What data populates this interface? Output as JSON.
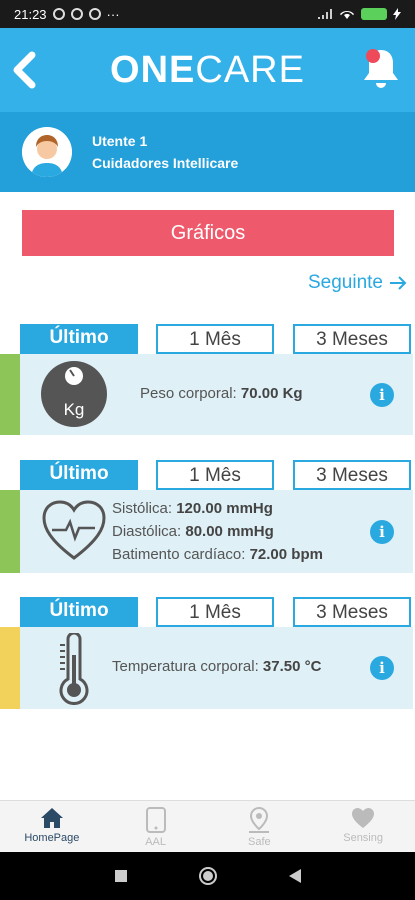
{
  "status_bar": {
    "time": "21:23",
    "dots": "···"
  },
  "header": {
    "logo_bold": "ONE",
    "logo_light": "CARE"
  },
  "user": {
    "name": "Utente 1",
    "org": "Cuidadores Intellicare"
  },
  "graficos_label": "Gráficos",
  "seguinte_label": "Seguinte",
  "tabs": {
    "latest": "Último",
    "month": "1 Mês",
    "three_months": "3 Meses"
  },
  "cards": [
    {
      "icon": "scale-kg-icon",
      "accent": "#8ec558",
      "badge": "Kg",
      "lines": [
        {
          "label": "Peso corporal: ",
          "value": "70.00 Kg"
        }
      ]
    },
    {
      "icon": "heart-pulse-icon",
      "accent": "#8ec558",
      "lines": [
        {
          "label": "Sistólica: ",
          "value": "120.00 mmHg"
        },
        {
          "label": "Diastólica: ",
          "value": "80.00 mmHg"
        },
        {
          "label": "Batimento cardíaco: ",
          "value": "72.00 bpm"
        }
      ]
    },
    {
      "icon": "thermometer-icon",
      "accent": "#f2d25a",
      "lines": [
        {
          "label": "Temperatura corporal: ",
          "value": "37.50 °C"
        }
      ]
    }
  ],
  "bottom_nav": [
    {
      "label": "HomePage",
      "icon": "home-icon",
      "active": true
    },
    {
      "label": "AAL",
      "icon": "tablet-icon",
      "active": false
    },
    {
      "label": "Safe",
      "icon": "location-pin-icon",
      "active": false
    },
    {
      "label": "Sensing",
      "icon": "heart-icon",
      "active": false
    }
  ],
  "colors": {
    "primary": "#33b1e8",
    "user_bar": "#239fd9",
    "graficos": "#ee5a6c",
    "card_bg": "#dff0f6"
  }
}
